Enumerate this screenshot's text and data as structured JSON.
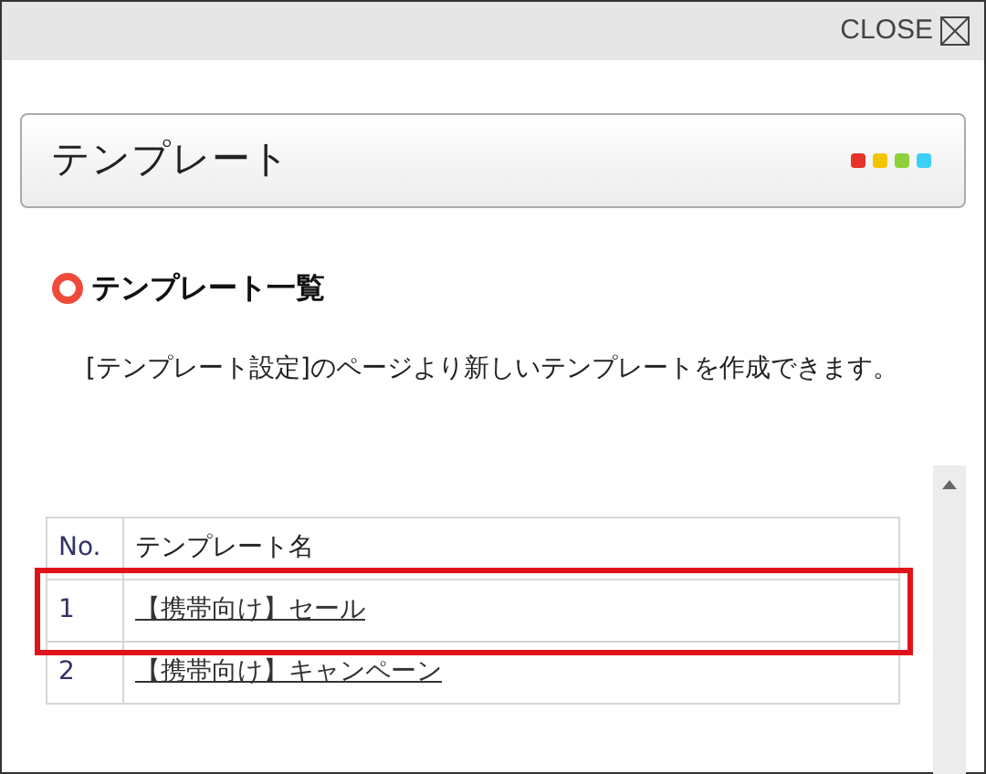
{
  "top_bar": {
    "close_label": "CLOSE"
  },
  "panel": {
    "title": "テンプレート"
  },
  "section": {
    "heading": "テンプレート一覧",
    "description": "[テンプレート設定]のページより新しいテンプレートを作成できます。"
  },
  "table": {
    "columns": [
      "No.",
      "テンプレート名"
    ],
    "rows": [
      {
        "number": "1",
        "name": "【携帯向け】セール",
        "highlighted": true
      },
      {
        "number": "2",
        "name": "【携帯向け】キャンペーン",
        "highlighted": false
      }
    ]
  }
}
